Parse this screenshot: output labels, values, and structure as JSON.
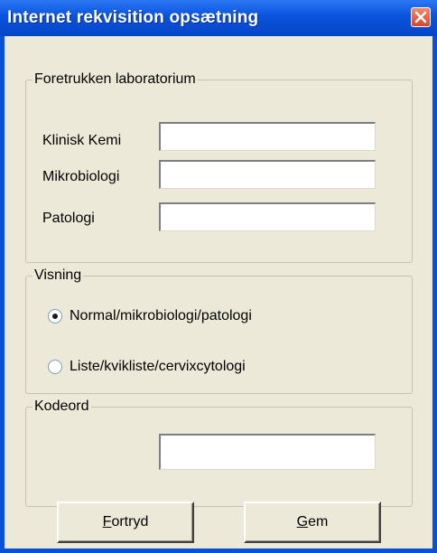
{
  "window": {
    "title": "Internet rekvisition opsætning",
    "close_icon": "close-icon"
  },
  "lab_group": {
    "legend": "Foretrukken laboratorium",
    "fields": [
      {
        "label": "Klinisk Kemi",
        "value": ""
      },
      {
        "label": "Mikrobiologi",
        "value": ""
      },
      {
        "label": "Patologi",
        "value": ""
      }
    ]
  },
  "view_group": {
    "legend": "Visning",
    "options": [
      {
        "label": "Normal/mikrobiologi/patologi",
        "selected": true
      },
      {
        "label": "Liste/kvikliste/cervixcytologi",
        "selected": false
      }
    ]
  },
  "password_group": {
    "legend": "Kodeord",
    "value": ""
  },
  "buttons": {
    "cancel": {
      "accel": "F",
      "rest": "ortryd"
    },
    "save": {
      "accel": "G",
      "rest": "em"
    }
  },
  "colors": {
    "titlebar": "#0a52dd",
    "dialog_bg": "#ece9d8",
    "close_button": "#d5452a"
  }
}
